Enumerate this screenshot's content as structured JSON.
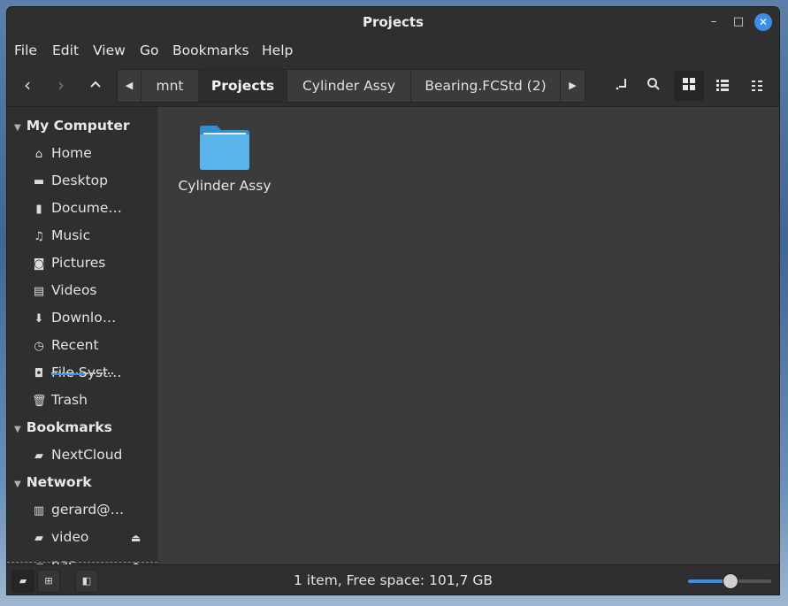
{
  "window": {
    "title": "Projects"
  },
  "menu": [
    "File",
    "Edit",
    "View",
    "Go",
    "Bookmarks",
    "Help"
  ],
  "breadcrumbs": [
    "mnt",
    "Projects",
    "Cylinder Assy",
    "Bearing.FCStd (2)"
  ],
  "active_crumb": "Projects",
  "sidebar": {
    "my_computer": {
      "label": "My Computer",
      "items": [
        {
          "label": "Home",
          "icon": "home-icon"
        },
        {
          "label": "Desktop",
          "icon": "desktop-icon"
        },
        {
          "label": "Docume…",
          "icon": "document-icon"
        },
        {
          "label": "Music",
          "icon": "music-icon"
        },
        {
          "label": "Pictures",
          "icon": "camera-icon"
        },
        {
          "label": "Videos",
          "icon": "film-icon"
        },
        {
          "label": "Downlo…",
          "icon": "download-icon"
        },
        {
          "label": "Recent",
          "icon": "clock-icon"
        },
        {
          "label": "File Syst…",
          "icon": "drive-icon"
        },
        {
          "label": "Trash",
          "icon": "trash-icon"
        }
      ]
    },
    "bookmarks": {
      "label": "Bookmarks",
      "items": [
        {
          "label": "NextCloud",
          "icon": "folder-icon"
        }
      ]
    },
    "network": {
      "label": "Network",
      "items": [
        {
          "label": "gerard@…",
          "icon": "server-icon"
        },
        {
          "label": "video",
          "icon": "network-folder-icon"
        },
        {
          "label": "nas",
          "icon": "network-folder-icon"
        }
      ]
    }
  },
  "files": [
    {
      "name": "Cylinder Assy",
      "type": "folder"
    }
  ],
  "status": {
    "text": "1 item, Free space: 101,7 GB",
    "zoom_level": 0.5
  },
  "colors": {
    "accent": "#3d8ee6",
    "folder": "#5ab4ec"
  }
}
